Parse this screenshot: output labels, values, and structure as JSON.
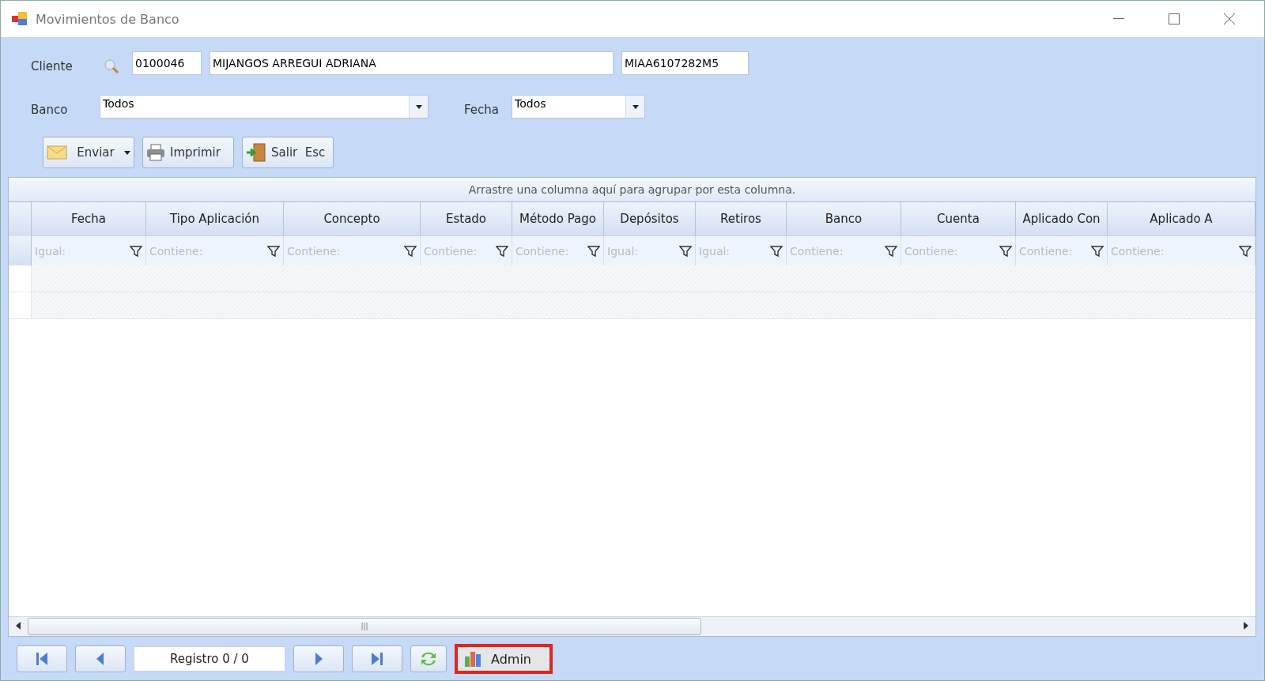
{
  "window": {
    "title": "Movimientos de Banco"
  },
  "cliente": {
    "label": "Cliente",
    "code": "0100046",
    "name": "MIJANGOS ARREGUI ADRIANA",
    "rfc": "MIAA6107282M5"
  },
  "banco": {
    "label": "Banco",
    "value": "Todos"
  },
  "fecha": {
    "label": "Fecha",
    "value": "Todos"
  },
  "toolbar": [
    {
      "kind": "send",
      "label": "Enviar"
    },
    {
      "kind": "print",
      "label": "Imprimir"
    },
    {
      "kind": "exit",
      "label": "Salir  Esc"
    }
  ],
  "grid": {
    "group_hint": "Arrastre una columna aquí para agrupar por esta columna.",
    "columns": [
      {
        "header": "Fecha",
        "filter": "Igual:"
      },
      {
        "header": "Tipo Aplicación",
        "filter": "Contiene:"
      },
      {
        "header": "Concepto",
        "filter": "Contiene:"
      },
      {
        "header": "Estado",
        "filter": "Contiene:"
      },
      {
        "header": "Método Pago",
        "filter": "Contiene:"
      },
      {
        "header": "Depósitos",
        "filter": "Igual:"
      },
      {
        "header": "Retiros",
        "filter": "Igual:"
      },
      {
        "header": "Banco",
        "filter": "Contiene:"
      },
      {
        "header": "Cuenta",
        "filter": "Contiene:"
      },
      {
        "header": "Aplicado Con",
        "filter": "Contiene:"
      },
      {
        "header": "Aplicado A",
        "filter": "Contiene:"
      }
    ]
  },
  "navigator": {
    "record": "Registro  0 / 0",
    "admin": {
      "label": "Admin",
      "highlighted": true
    }
  }
}
